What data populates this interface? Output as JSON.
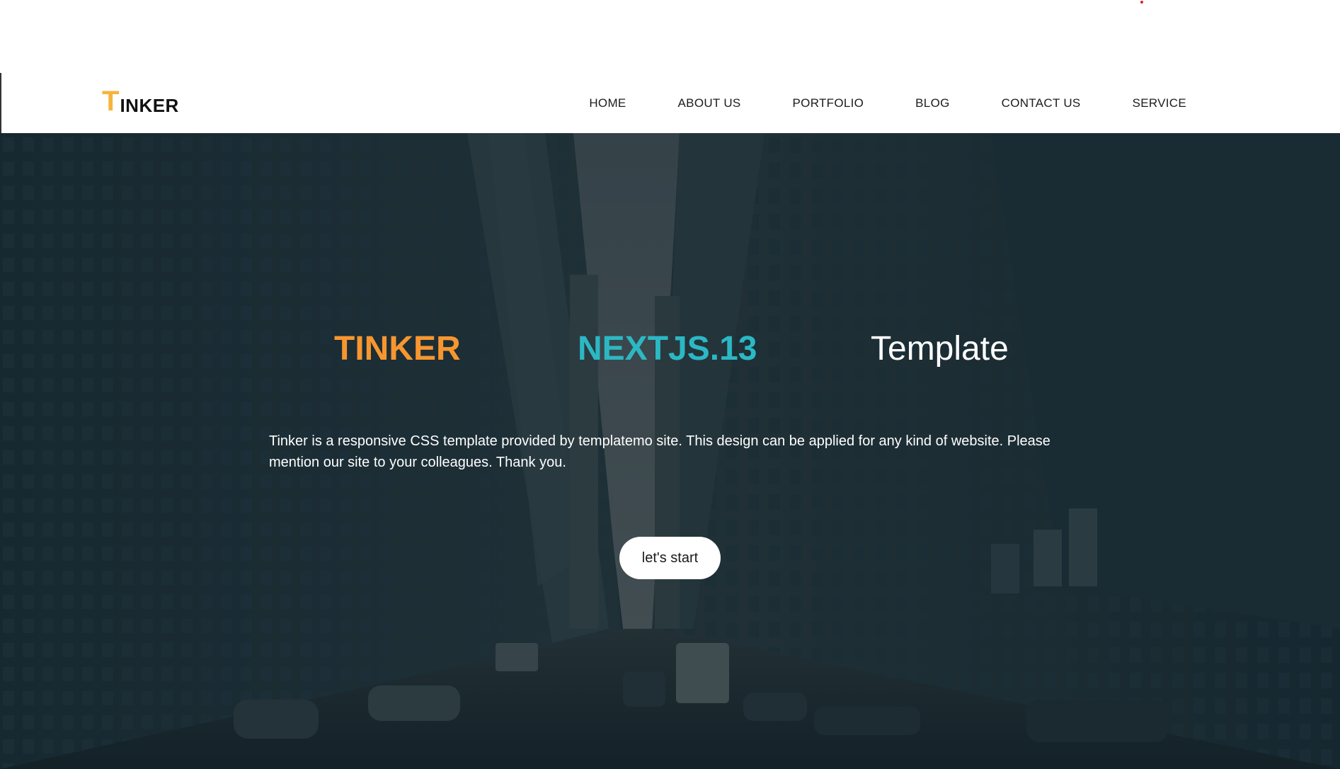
{
  "brand": {
    "logo_initial": "T",
    "logo_rest": "INKER"
  },
  "nav": {
    "items": [
      "HOME",
      "ABOUT US",
      "PORTFOLIO",
      "BLOG",
      "CONTACT US",
      "SERVICE"
    ]
  },
  "hero": {
    "headline_1": "TINKER",
    "headline_2": "NEXTJS.13",
    "headline_3": "Template",
    "description": "Tinker is a responsive CSS template provided by templatemo site. This design can be applied for any kind of website. Please mention our site to your colleagues. Thank you.",
    "cta_label": "let's start"
  },
  "colors": {
    "logo_accent": "#f6b43a",
    "headline_orange": "#f7962f",
    "headline_teal": "#2bb8c4",
    "hero_overlay": "#1a2c33"
  }
}
